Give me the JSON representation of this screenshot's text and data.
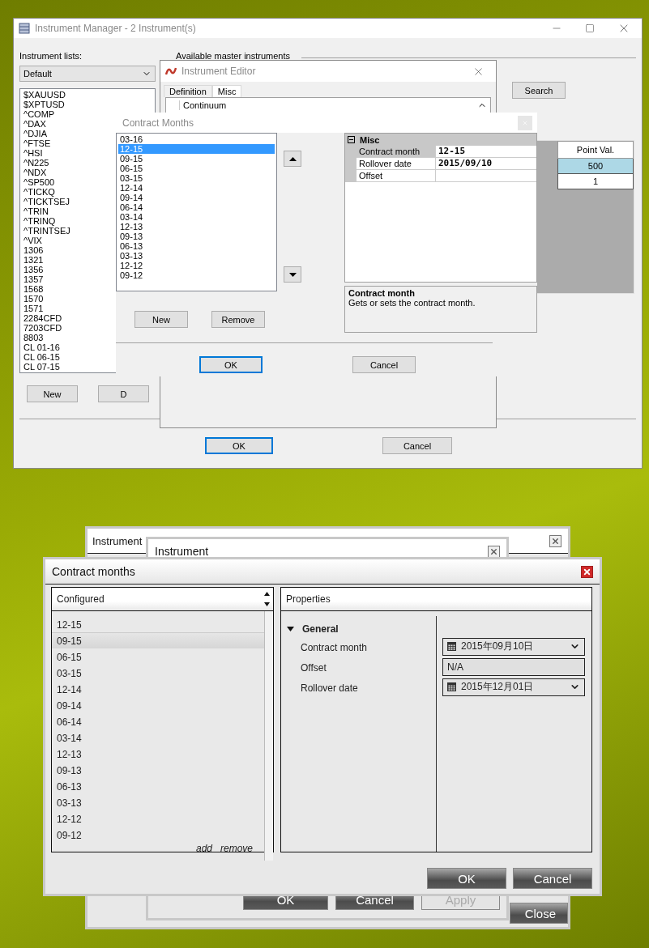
{
  "instrument_manager": {
    "title": "Instrument Manager - 2 Instrument(s)",
    "lists_label": "Instrument lists:",
    "list_choice": "Default",
    "instruments": [
      "$XAUUSD",
      "$XPTUSD",
      "^COMP",
      "^DAX",
      "^DJIA",
      "^FTSE",
      "^HSI",
      "^N225",
      "^NDX",
      "^SP500",
      "^TICKQ",
      "^TICKTSEJ",
      "^TRIN",
      "^TRINQ",
      "^TRINTSEJ",
      "^VIX",
      "1306",
      "1321",
      "1356",
      "1357",
      "1568",
      "1570",
      "1571",
      "2284CFD",
      "7203CFD",
      "8803",
      "CL 01-16",
      "CL 06-15",
      "CL 07-15"
    ],
    "list_buttons": [
      "New",
      "D"
    ],
    "master_label": "Available master instruments",
    "search_button": "Search",
    "grid": {
      "columns": [
        "Point Val."
      ],
      "rows": [
        {
          "cells": [
            "500"
          ],
          "selected": true
        },
        {
          "cells": [
            "1"
          ],
          "selected": false
        }
      ]
    },
    "ok_button": "OK",
    "cancel_button": "Cancel"
  },
  "instrument_editor": {
    "title": "Instrument Editor",
    "tabs": [
      {
        "label": "Definition",
        "selected": false
      },
      {
        "label": "Misc",
        "selected": true
      }
    ],
    "grid_row": "Continuum"
  },
  "contract_months_dialog": {
    "title": "Contract Months",
    "months": [
      {
        "label": "03-16",
        "selected": false
      },
      {
        "label": "12-15",
        "selected": true
      },
      {
        "label": "09-15",
        "selected": false
      },
      {
        "label": "06-15",
        "selected": false
      },
      {
        "label": "03-15",
        "selected": false
      },
      {
        "label": "12-14",
        "selected": false
      },
      {
        "label": "09-14",
        "selected": false
      },
      {
        "label": "06-14",
        "selected": false
      },
      {
        "label": "03-14",
        "selected": false
      },
      {
        "label": "12-13",
        "selected": false
      },
      {
        "label": "09-13",
        "selected": false
      },
      {
        "label": "06-13",
        "selected": false
      },
      {
        "label": "03-13",
        "selected": false
      },
      {
        "label": "12-12",
        "selected": false
      },
      {
        "label": "09-12",
        "selected": false
      }
    ],
    "buttons": [
      "New",
      "Remove"
    ],
    "property_grid": {
      "category": "Misc",
      "expanded": true,
      "rows": [
        {
          "name": "Contract month",
          "value": "12-15",
          "selected": true
        },
        {
          "name": "Rollover date",
          "value": "2015/09/10",
          "selected": false
        },
        {
          "name": "Offset",
          "selected": false
        }
      ]
    },
    "description": {
      "title": "Contract month",
      "text": "Gets or sets the contract month."
    },
    "ok_button": "OK",
    "cancel_button": "Cancel"
  },
  "instruments_window": {
    "title": "Instrument",
    "close_button": "Close"
  },
  "instrument_window": {
    "title": "Instrument",
    "buttons": [
      {
        "label": "OK",
        "disabled": false
      },
      {
        "label": "Cancel",
        "disabled": false
      },
      {
        "label": "Apply",
        "disabled": true
      }
    ]
  },
  "contract_months_window": {
    "title": "Contract months",
    "list_header": "Configured",
    "months": [
      {
        "label": "12-15",
        "selected": false
      },
      {
        "label": "09-15",
        "selected": true
      },
      {
        "label": "06-15",
        "selected": false
      },
      {
        "label": "03-15",
        "selected": false
      },
      {
        "label": "12-14",
        "selected": false
      },
      {
        "label": "09-14",
        "selected": false
      },
      {
        "label": "06-14",
        "selected": false
      },
      {
        "label": "03-14",
        "selected": false
      },
      {
        "label": "12-13",
        "selected": false
      },
      {
        "label": "09-13",
        "selected": false
      },
      {
        "label": "06-13",
        "selected": false
      },
      {
        "label": "03-13",
        "selected": false
      },
      {
        "label": "12-12",
        "selected": false
      },
      {
        "label": "09-12",
        "selected": false
      }
    ],
    "links": [
      "add",
      "remove"
    ],
    "properties_header": "Properties",
    "category": {
      "label": "General",
      "expanded": true
    },
    "properties": [
      {
        "name": "Contract month",
        "kind": "date",
        "value": "2015年09月10日"
      },
      {
        "name": "Offset",
        "kind": "text",
        "value": "N/A"
      },
      {
        "name": "Rollover date",
        "kind": "date",
        "value": "2015年12月01日"
      }
    ],
    "buttons": [
      "OK",
      "Cancel"
    ]
  }
}
